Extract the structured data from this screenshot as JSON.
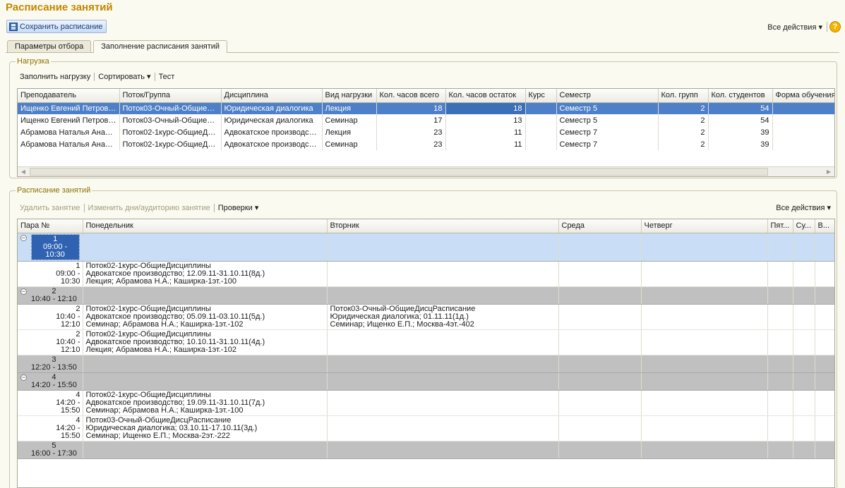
{
  "header": {
    "title": "Расписание занятий",
    "save_label": "Сохранить расписание",
    "all_actions": "Все действия ▾",
    "help": "?"
  },
  "tabs": [
    {
      "label": "Параметры отбора"
    },
    {
      "label": "Заполнение расписания занятий"
    }
  ],
  "load": {
    "group_label": "Нагрузка",
    "toolbar": {
      "fill": "Заполнить нагрузку",
      "sort": "Сортировать ▾",
      "test": "Тест"
    },
    "columns": [
      "Преподаватель",
      "Поток/Группа",
      "Дисциплина",
      "Вид нагрузки",
      "Кол. часов всего",
      "Кол. часов остаток",
      "Курс",
      "Семестр",
      "Кол. групп",
      "Кол. студентов",
      "Форма обучения"
    ],
    "rows": [
      {
        "teacher": "Ищенко Евгений Петрович",
        "group": "Поток03-Очный-ОбщиеДи...",
        "discipline": "Юридическая диалогика",
        "kind": "Лекция",
        "total": "18",
        "remain": "18",
        "course": "",
        "semester": "Семестр 5",
        "groups": "2",
        "students": "54",
        "form": ""
      },
      {
        "teacher": "Ищенко Евгений Петрович",
        "group": "Поток03-Очный-ОбщиеДи...",
        "discipline": "Юридическая диалогика",
        "kind": "Семинар",
        "total": "17",
        "remain": "13",
        "course": "",
        "semester": "Семестр 5",
        "groups": "2",
        "students": "54",
        "form": ""
      },
      {
        "teacher": "Абрамова Наталья Анато...",
        "group": "Поток02-1курс-ОбщиеДи...",
        "discipline": "Адвокатское производство",
        "kind": "Лекция",
        "total": "23",
        "remain": "11",
        "course": "",
        "semester": "Семестр 7",
        "groups": "2",
        "students": "39",
        "form": ""
      },
      {
        "teacher": "Абрамова Наталья Анато...",
        "group": "Поток02-1курс-ОбщиеДи...",
        "discipline": "Адвокатское производство",
        "kind": "Семинар",
        "total": "23",
        "remain": "11",
        "course": "",
        "semester": "Семестр 7",
        "groups": "2",
        "students": "39",
        "form": ""
      }
    ]
  },
  "schedule": {
    "group_label": "Расписание занятий",
    "toolbar": {
      "delete": "Удалить занятие",
      "edit": "Изменить дни/аудиторию занятие",
      "checks": "Проверки ▾",
      "all_actions": "Все действия ▾"
    },
    "columns": [
      "Пара №",
      "Понедельник",
      "Вторник",
      "Среда",
      "Четверг",
      "Пят...",
      "Су...",
      "В..."
    ],
    "groups": [
      {
        "num": "1",
        "time": "09:00 - 10:30",
        "items": [
          {
            "num": "1",
            "t1": "09:00 -",
            "t2": "10:30",
            "mon": [
              "Поток02-1курс-ОбщиеДисциплины",
              "Адвокатское производство; 12.09.11-31.10.11(8д.)",
              "Лекция; Абрамова Н.А.; Каширка-1эт.-100"
            ],
            "tue": []
          }
        ]
      },
      {
        "num": "2",
        "time": "10:40 - 12:10",
        "items": [
          {
            "num": "2",
            "t1": "10:40 -",
            "t2": "12:10",
            "mon": [
              "Поток02-1курс-ОбщиеДисциплины",
              "Адвокатское производство; 05.09.11-03.10.11(5д.)",
              "Семинар; Абрамова Н.А.; Каширка-1эт.-102"
            ],
            "tue": [
              "Поток03-Очный-ОбщиеДисцРасписание",
              "Юридическая диалогика; 01.11.11(1д.)",
              "Семинар; Ищенко Е.П.; Москва-4эт.-402"
            ]
          },
          {
            "num": "2",
            "t1": "10:40 -",
            "t2": "12:10",
            "mon": [
              "Поток02-1курс-ОбщиеДисциплины",
              "Адвокатское производство; 10.10.11-31.10.11(4д.)",
              "Лекция; Абрамова Н.А.; Каширка-1эт.-102"
            ],
            "tue": []
          }
        ]
      },
      {
        "num": "3",
        "time": "12:20 - 13:50",
        "items": []
      },
      {
        "num": "4",
        "time": "14:20 - 15:50",
        "items": [
          {
            "num": "4",
            "t1": "14:20 -",
            "t2": "15:50",
            "mon": [
              "Поток02-1курс-ОбщиеДисциплины",
              "Адвокатское производство; 19.09.11-31.10.11(7д.)",
              "Семинар; Абрамова Н.А.; Каширка-1эт.-100"
            ],
            "tue": []
          },
          {
            "num": "4",
            "t1": "14:20 -",
            "t2": "15:50",
            "mon": [
              "Поток03-Очный-ОбщиеДисцРасписание",
              "Юридическая диалогика; 03.10.11-17.10.11(3д.)",
              "Семинар; Ищенко Е.П.; Москва-2эт.-222"
            ],
            "tue": []
          }
        ]
      },
      {
        "num": "5",
        "time": "16:00 - 17:30",
        "items": []
      }
    ]
  }
}
